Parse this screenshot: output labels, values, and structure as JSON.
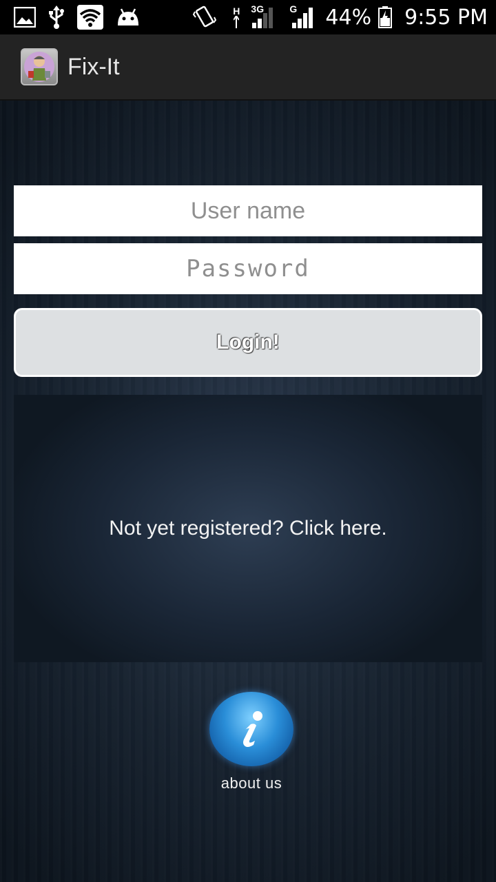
{
  "status_bar": {
    "battery_percent": "44%",
    "time": "9:55 PM",
    "network_3g": "3G",
    "network_g": "G",
    "network_h": "H",
    "icons": [
      "gallery-icon",
      "usb-icon",
      "wifi-icon",
      "android-icon",
      "vibrate-icon",
      "signal-3g-icon",
      "signal-g-icon",
      "battery-icon"
    ]
  },
  "action_bar": {
    "title": "Fix-It",
    "icon": "app-logo-icon"
  },
  "login_form": {
    "username_placeholder": "User name",
    "password_placeholder": "Password",
    "login_label": "Login!"
  },
  "register": {
    "text": "Not yet registered? Click here."
  },
  "about": {
    "label": "about us",
    "icon": "info-icon"
  },
  "colors": {
    "status_bar_bg": "#000000",
    "action_bar_bg": "#232323",
    "background": "#17222f",
    "button_bg": "#dde0e2",
    "accent_info": "#2a8ed8"
  }
}
